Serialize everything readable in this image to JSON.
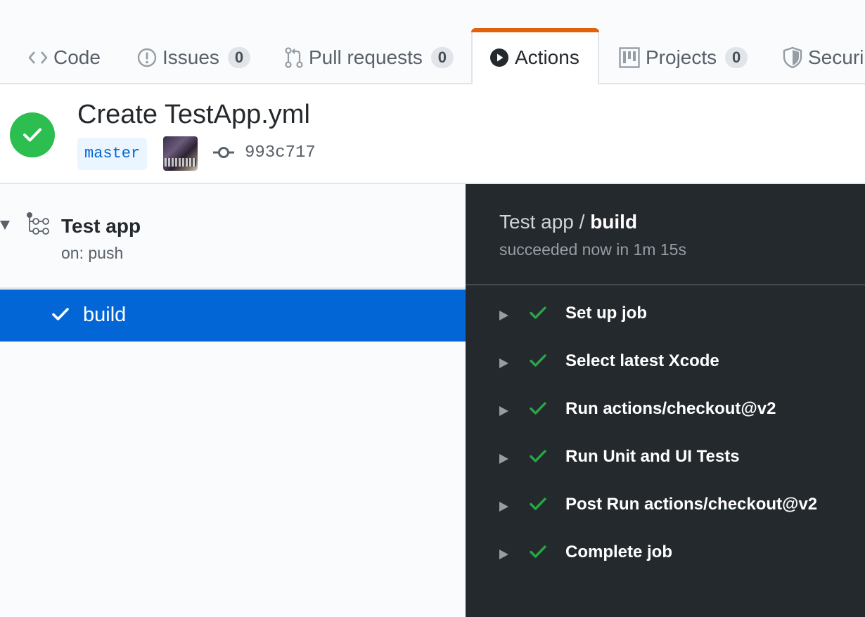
{
  "tabs": [
    {
      "label": "Code",
      "icon": "code-icon"
    },
    {
      "label": "Issues",
      "icon": "issue-icon",
      "count": "0"
    },
    {
      "label": "Pull requests",
      "icon": "pull-request-icon",
      "count": "0"
    },
    {
      "label": "Actions",
      "icon": "play-icon",
      "active": true
    },
    {
      "label": "Projects",
      "icon": "project-icon",
      "count": "0"
    },
    {
      "label": "Securi",
      "icon": "shield-icon"
    }
  ],
  "colors": {
    "active_tab_accent": "#e36209",
    "success": "#2cbe4e",
    "selected_job": "#0366d6",
    "log_background": "#24292e"
  },
  "run": {
    "title": "Create TestApp.yml",
    "status": "success",
    "branch": "master",
    "commit_sha": "993c717"
  },
  "workflow": {
    "name": "Test app",
    "trigger": "on: push",
    "jobs": [
      {
        "name": "build",
        "status": "success",
        "selected": true
      }
    ]
  },
  "log": {
    "workflow_name": "Test app /",
    "job_name": "build",
    "summary": "succeeded now in 1m 15s",
    "steps": [
      {
        "label": "Set up job",
        "status": "success"
      },
      {
        "label": "Select latest Xcode",
        "status": "success"
      },
      {
        "label": "Run actions/checkout@v2",
        "status": "success"
      },
      {
        "label": "Run Unit and UI Tests",
        "status": "success"
      },
      {
        "label": "Post Run actions/checkout@v2",
        "status": "success"
      },
      {
        "label": "Complete job",
        "status": "success"
      }
    ]
  }
}
